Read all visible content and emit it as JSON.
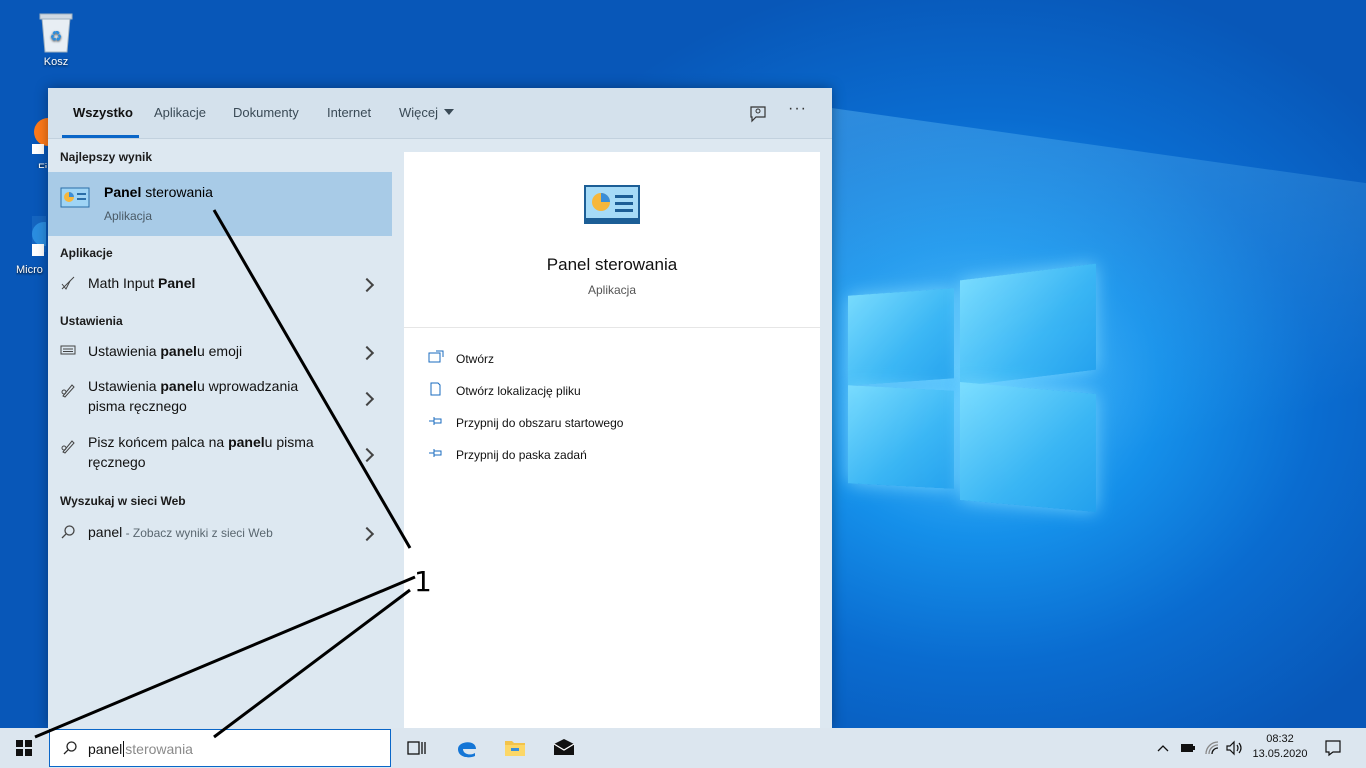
{
  "desktop": {
    "recycle_bin_label": "Kosz",
    "side_labels": [
      "Fi",
      "Micro"
    ]
  },
  "search_panel": {
    "tabs": [
      {
        "label": "Wszystko",
        "active": true
      },
      {
        "label": "Aplikacje",
        "active": false
      },
      {
        "label": "Dokumenty",
        "active": false
      },
      {
        "label": "Internet",
        "active": false
      },
      {
        "label": "Więcej",
        "active": false
      }
    ],
    "best_match": {
      "section": "Najlepszy wynik",
      "title_bold": "Panel",
      "title_rest": " sterowania",
      "subtitle": "Aplikacja"
    },
    "apps": {
      "section": "Aplikacje",
      "items": [
        {
          "pre": "Math Input ",
          "bold": "Panel",
          "post": ""
        }
      ]
    },
    "settings": {
      "section": "Ustawienia",
      "items": [
        {
          "l1_pre": "Ustawienia ",
          "l1_bold": "panel",
          "l1_post": "u emoji",
          "l2": ""
        },
        {
          "l1_pre": "Ustawienia ",
          "l1_bold": "panel",
          "l1_post": "u wprowadzania",
          "l2": "pisma ręcznego"
        },
        {
          "l1_pre": "Pisz końcem palca na ",
          "l1_bold": "panel",
          "l1_post": "u pisma",
          "l2": "ręcznego"
        }
      ]
    },
    "web": {
      "section": "Wyszukaj w sieci Web",
      "query": "panel",
      "hint": " - Zobacz wyniki z sieci Web"
    },
    "detail": {
      "title": "Panel sterowania",
      "subtitle": "Aplikacja",
      "actions": [
        {
          "icon": "open-icon",
          "label": "Otwórz"
        },
        {
          "icon": "file-location-icon",
          "label": "Otwórz lokalizację pliku"
        },
        {
          "icon": "pin-icon",
          "label": "Przypnij do obszaru startowego"
        },
        {
          "icon": "pin-icon",
          "label": "Przypnij do paska zadań"
        }
      ]
    }
  },
  "taskbar": {
    "search_typed": "panel",
    "search_suggestion": "sterowania",
    "time": "08:32",
    "date": "13.05.2020"
  },
  "annotation": {
    "label": "1"
  },
  "colors": {
    "accent": "#0a66c8",
    "best_match_bg": "#a8cbe7",
    "panel_bg": "#dde8f1",
    "taskbar_bg": "#dce6ef"
  }
}
